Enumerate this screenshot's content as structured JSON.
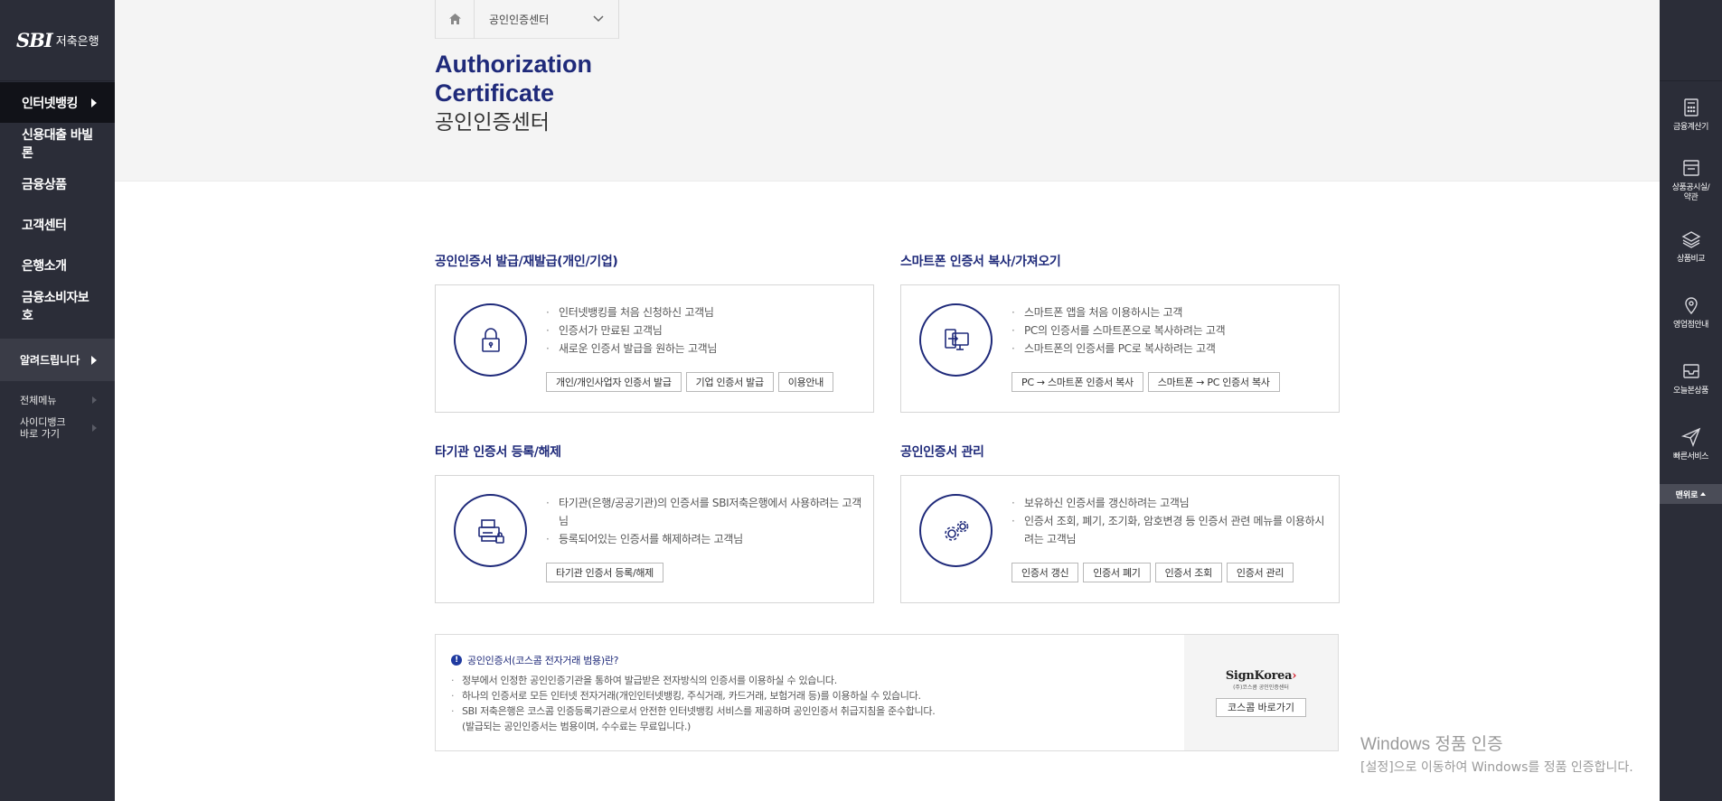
{
  "logo": {
    "brand": "SBI",
    "bank": "저축은행"
  },
  "lnb": {
    "main_items": [
      {
        "label": "인터넷뱅킹"
      },
      {
        "label": "신용대출 바빌론"
      },
      {
        "label": "금융상품"
      },
      {
        "label": "고객센터"
      },
      {
        "label": "은행소개"
      },
      {
        "label": "금융소비자보호"
      }
    ],
    "notice": "알려드립니다",
    "sub_items": [
      {
        "label": "전체메뉴"
      },
      {
        "label": "사이디뱅크",
        "label2": "바로 가기"
      }
    ]
  },
  "quick": {
    "items": [
      {
        "label": "금융계산기",
        "icon": "calculator-icon"
      },
      {
        "label": "상품공시실/",
        "label2": "약관",
        "icon": "document-icon"
      },
      {
        "label": "상품비교",
        "icon": "layers-icon"
      },
      {
        "label": "영업점안내",
        "icon": "location-icon"
      },
      {
        "label": "오늘본상품",
        "icon": "inbox-icon"
      },
      {
        "label": "빠른서비스",
        "icon": "paper-plane-icon"
      }
    ],
    "top": "맨위로"
  },
  "breadcrumb": {
    "current": "공인인증센터"
  },
  "title": {
    "en1": "Authorization",
    "en2": "Certificate",
    "ko": "공인인증센터"
  },
  "sections": [
    {
      "title": "공인인증서 발급/재발급(개인/기업)",
      "icon": "lock-icon",
      "bullets": [
        "인터넷뱅킹를 처음 신청하신 고객님",
        "인증서가 만료된 고객님",
        "새로운 인증서 발급을 원하는 고객님"
      ],
      "buttons": [
        "개인/개인사업자 인증서 발급",
        "기업 인증서 발급",
        "이용안내"
      ]
    },
    {
      "title": "스마트폰 인증서 복사/가져오기",
      "icon": "device-transfer-icon",
      "bullets": [
        "스마트폰 앱을 처음 이용하시는 고객",
        "PC의 인증서를 스마트폰으로 복사하려는 고객",
        "스마트폰의 인증서를 PC로 복사하려는 고객"
      ],
      "buttons": [
        "PC → 스마트폰 인증서 복사",
        "스마트폰 → PC 인증서 복사"
      ]
    },
    {
      "title": "타기관 인증서 등록/해제",
      "icon": "printer-lock-icon",
      "bullets": [
        "타기관(은행/공공기관)의 인증서를 SBI저축은행에서 사용하려는 고객님",
        "등록되어있는 인증서를 해제하려는 고객님"
      ],
      "buttons": [
        "타기관 인증서 등록/해제"
      ]
    },
    {
      "title": "공인인증서 관리",
      "icon": "gears-icon",
      "bullets": [
        "보유하신 인증서를 갱신하려는 고객님",
        "인증서 조회, 폐기, 조기화, 암호변경 등 인증서 관련 메뉴를 이용하시려는 고객님"
      ],
      "buttons": [
        "인증서 갱신",
        "인증서 폐기",
        "인증서 조회",
        "인증서 관리"
      ]
    }
  ],
  "info": {
    "title": "공인인증서(코스콤 전자거래 범용)란?",
    "lines": [
      "정부에서 인정한 공인인증기관을 통하여 발급받은 전자방식의 인증서를 이용하실 수 있습니다.",
      "하나의 인증서로 모든 인터넷 전자거래(개인인터넷뱅킹, 주식거래, 카드거래, 보험거래 등)를 이용하실 수 있습니다.",
      "SBI 저축은행은 코스콤 인증등록기관으로서 안전한 인터넷뱅킹 서비스를 제공하며 공인인증서 취급지침을 준수합니다.",
      "(발급되는 공인인증서는 범용이며, 수수료는 무료입니다.)"
    ],
    "signkorea": {
      "name": "SignKorea",
      "sub": "(주)코스콤 공인인증센터"
    },
    "koscom_btn": "코스콤 바로가기"
  },
  "watermark": {
    "title": "Windows 정품 인증",
    "sub": "[설정]으로 이동하여 Windows를 정품 인증합니다."
  }
}
